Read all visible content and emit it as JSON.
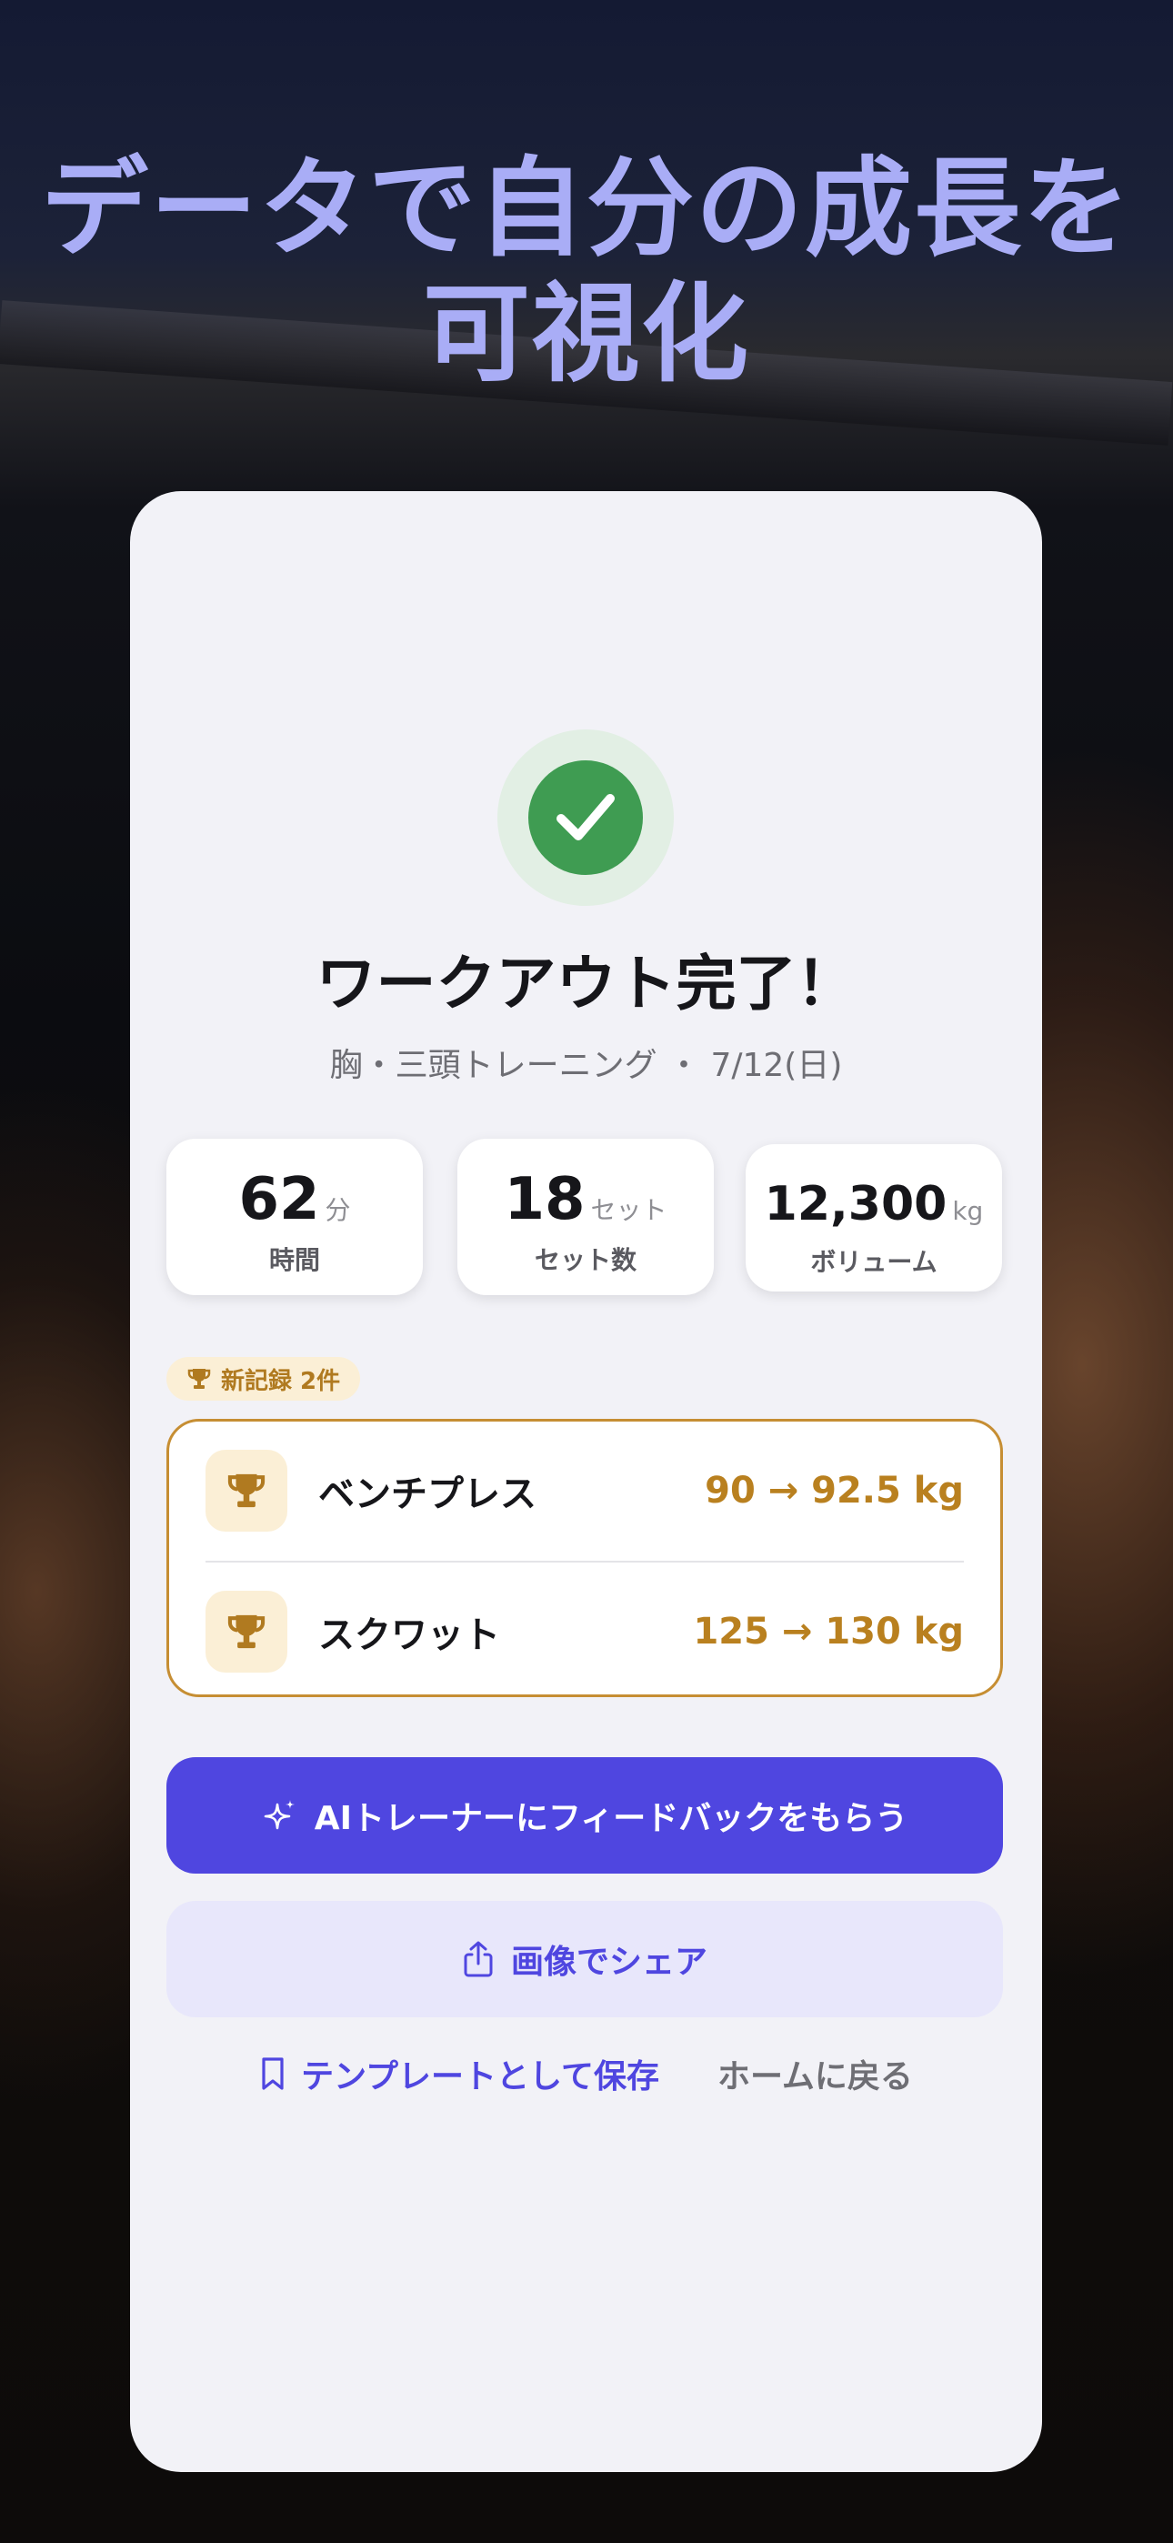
{
  "headline": {
    "line1": "データで自分の成長を",
    "line2": "可視化"
  },
  "summary": {
    "title": "ワークアウト完了！",
    "subtitle": "胸・三頭トレーニング ・ 7/12(日)",
    "stats": [
      {
        "value": "62",
        "unit": "分",
        "label": "時間"
      },
      {
        "value": "18",
        "unit": "セット",
        "label": "セット数"
      },
      {
        "value": "12,300",
        "unit": "kg",
        "label": "ボリューム"
      }
    ],
    "records_badge": "新記録 2件",
    "records": [
      {
        "name": "ベンチプレス",
        "value": "90 → 92.5 kg"
      },
      {
        "name": "スクワット",
        "value": "125 → 130 kg"
      }
    ],
    "ai_feedback_button": "AIトレーナーにフィードバックをもらう",
    "share_button": "画像でシェア",
    "save_template_link": "テンプレートとして保存",
    "home_link": "ホームに戻る"
  },
  "colors": {
    "accent": "#4f46e0",
    "gold": "#b9801f",
    "success": "#3f9c52",
    "headline": "#a9adf6"
  },
  "icons": [
    "check-icon",
    "trophy-icon",
    "sparkle-icon",
    "share-icon",
    "bookmark-icon"
  ]
}
